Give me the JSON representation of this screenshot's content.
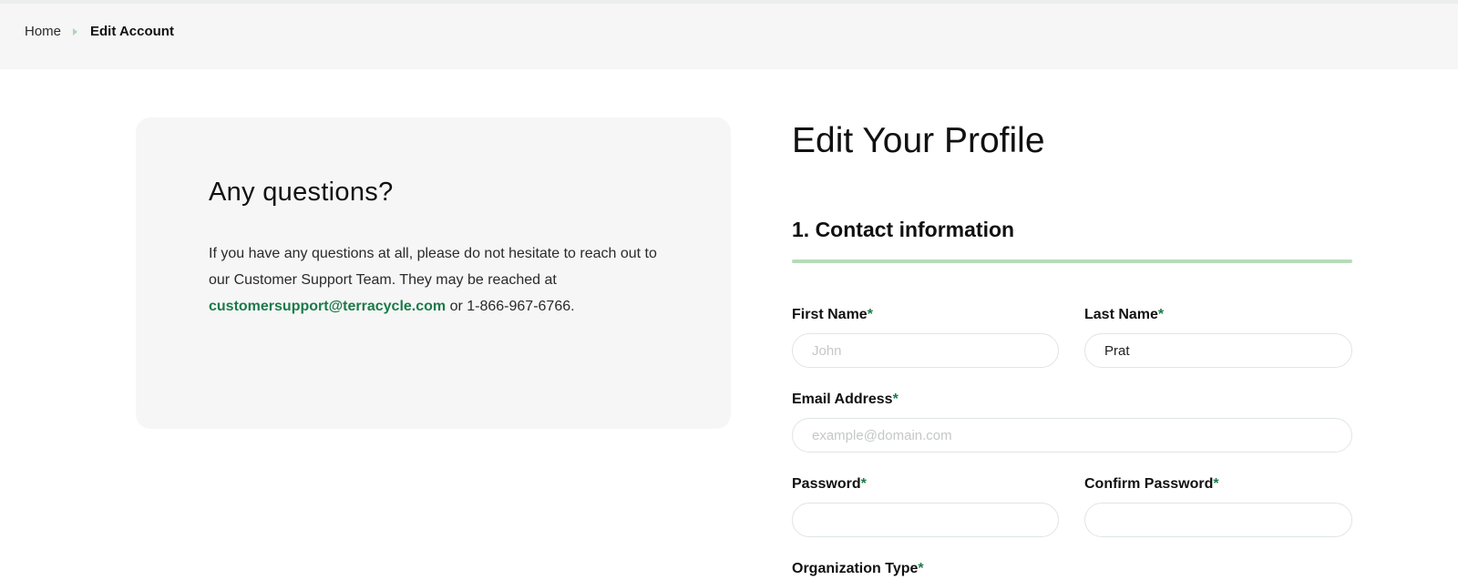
{
  "breadcrumb": {
    "home": "Home",
    "current": "Edit Account"
  },
  "questions": {
    "title": "Any questions?",
    "body_before": "If you have any questions at all, please do not hesitate to reach out to our Customer Support Team. They may be reached at ",
    "email": "customersupport@terracycle.com",
    "body_after": " or 1-866-967-6766."
  },
  "form": {
    "title": "Edit Your Profile",
    "section_title": "1. Contact information",
    "required_marker": "*",
    "first_name": {
      "label": "First Name",
      "placeholder": "John",
      "value": ""
    },
    "last_name": {
      "label": "Last Name",
      "placeholder": "",
      "value": "Prat"
    },
    "email": {
      "label": "Email Address",
      "placeholder": "example@domain.com",
      "value": ""
    },
    "password": {
      "label": "Password",
      "value": ""
    },
    "confirm_password": {
      "label": "Confirm Password",
      "value": ""
    },
    "organization_type": {
      "label": "Organization Type"
    }
  },
  "colors": {
    "accent_green": "#1c7a4a",
    "divider_green": "#b5dbb9",
    "panel_gray": "#f6f6f6"
  },
  "icons": {
    "breadcrumb_separator": "chevron-right-icon"
  }
}
